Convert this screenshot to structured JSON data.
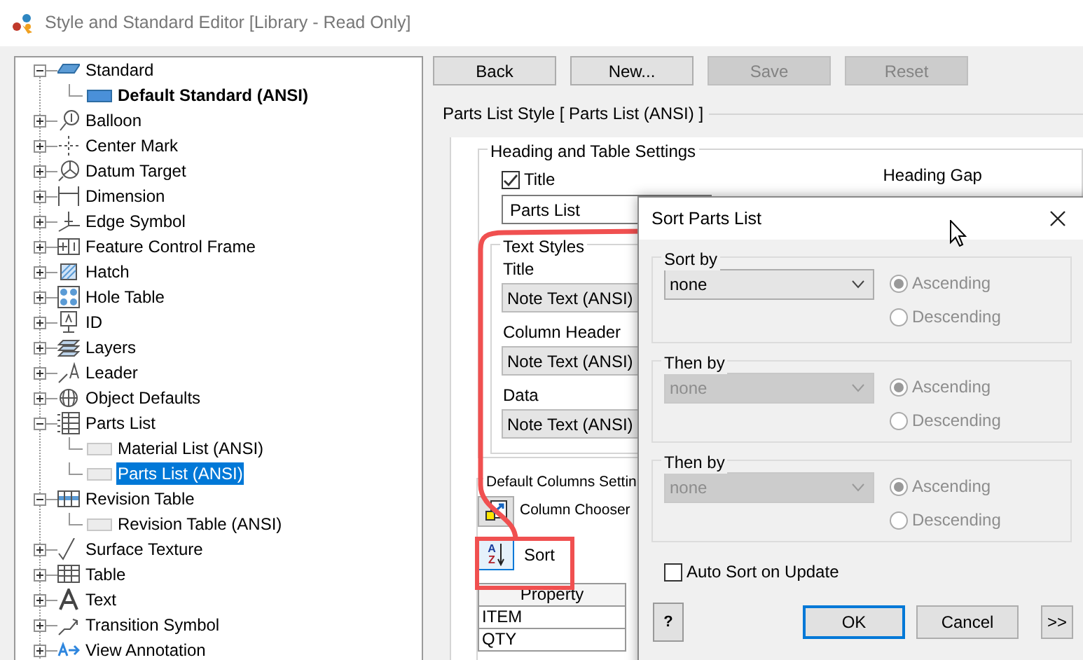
{
  "window": {
    "title": "Style and Standard Editor [Library - Read Only]"
  },
  "tree": [
    {
      "label": "Standard",
      "expanded": true,
      "children": [
        {
          "label": "Default Standard (ANSI)",
          "active": true,
          "selected": false
        }
      ]
    },
    {
      "label": "Balloon",
      "expanded": false
    },
    {
      "label": "Center Mark",
      "expanded": false
    },
    {
      "label": "Datum Target",
      "expanded": false
    },
    {
      "label": "Dimension",
      "expanded": false
    },
    {
      "label": "Edge Symbol",
      "expanded": false
    },
    {
      "label": "Feature Control Frame",
      "expanded": false
    },
    {
      "label": "Hatch",
      "expanded": false
    },
    {
      "label": "Hole Table",
      "expanded": false
    },
    {
      "label": "ID",
      "expanded": false
    },
    {
      "label": "Layers",
      "expanded": false
    },
    {
      "label": "Leader",
      "expanded": false
    },
    {
      "label": "Object Defaults",
      "expanded": false
    },
    {
      "label": "Parts List",
      "expanded": true,
      "children": [
        {
          "label": "Material List (ANSI)",
          "active": false,
          "selected": false
        },
        {
          "label": "Parts List (ANSI)",
          "active": false,
          "selected": true
        }
      ]
    },
    {
      "label": "Revision Table",
      "expanded": true,
      "children": [
        {
          "label": "Revision Table (ANSI)",
          "active": false,
          "selected": false
        }
      ]
    },
    {
      "label": "Surface Texture",
      "expanded": false
    },
    {
      "label": "Table",
      "expanded": false
    },
    {
      "label": "Text",
      "expanded": false
    },
    {
      "label": "Transition Symbol",
      "expanded": false
    },
    {
      "label": "View Annotation",
      "expanded": false
    }
  ],
  "toolbar": [
    {
      "label": "Back",
      "disabled": false
    },
    {
      "label": "New...",
      "disabled": false
    },
    {
      "label": "Save",
      "disabled": true
    },
    {
      "label": "Reset",
      "disabled": true
    }
  ],
  "style_panel": {
    "title": "Parts List Style [ Parts List (ANSI) ]",
    "heading_group": {
      "title": "Heading and Table Settings",
      "title_checkbox": {
        "label": "Title",
        "checked": true
      },
      "heading_gap_label": "Heading Gap",
      "title_value": "Parts List"
    },
    "text_styles": {
      "title": "Text Styles",
      "fields": [
        {
          "label": "Title",
          "value": "Note Text (ANSI)"
        },
        {
          "label": "Column Header",
          "value": "Note Text (ANSI)"
        },
        {
          "label": "Data",
          "value": "Note Text (ANSI)"
        }
      ]
    },
    "columns_group": {
      "title": "Default Columns Settin",
      "column_chooser": "Column Chooser",
      "sort": "Sort",
      "sort_icon_letters": [
        "A",
        "Z"
      ],
      "table": {
        "columns": [
          "Property"
        ],
        "rows": [
          "ITEM",
          "QTY"
        ]
      }
    }
  },
  "dialog": {
    "title": "Sort Parts List",
    "groups": [
      {
        "label": "Sort by",
        "value": "none",
        "disabled": false,
        "options": [
          {
            "label": "Ascending",
            "selected": true,
            "disabled": true
          },
          {
            "label": "Descending",
            "selected": false,
            "disabled": true
          }
        ]
      },
      {
        "label": "Then by",
        "value": "none",
        "disabled": true,
        "options": [
          {
            "label": "Ascending",
            "selected": true,
            "disabled": true
          },
          {
            "label": "Descending",
            "selected": false,
            "disabled": true
          }
        ]
      },
      {
        "label": "Then by",
        "value": "none",
        "disabled": true,
        "options": [
          {
            "label": "Ascending",
            "selected": true,
            "disabled": true
          },
          {
            "label": "Descending",
            "selected": false,
            "disabled": true
          }
        ]
      }
    ],
    "auto_sort": {
      "label": "Auto Sort on Update",
      "checked": false
    },
    "help_button": "?",
    "buttons": [
      {
        "label": "OK",
        "default": true
      },
      {
        "label": "Cancel",
        "default": false
      },
      {
        "label": ">>",
        "default": false
      }
    ]
  }
}
